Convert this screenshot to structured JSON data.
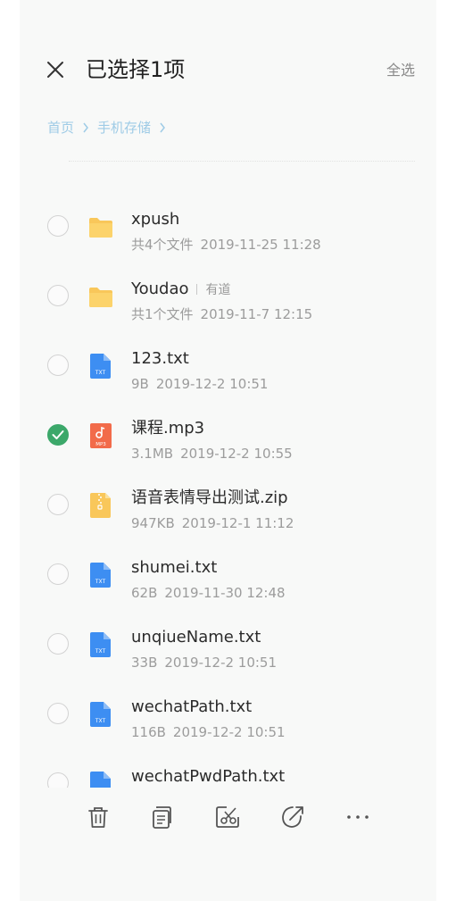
{
  "header": {
    "title": "已选择1项",
    "select_all": "全选"
  },
  "breadcrumb": [
    "首页",
    "手机存储"
  ],
  "files": [
    {
      "name": "xpush",
      "tag": "",
      "meta": "共4个文件",
      "date": "2019-11-25 11:28",
      "type": "folder",
      "checked": false
    },
    {
      "name": "Youdao",
      "tag": "有道",
      "meta": "共1个文件",
      "date": "2019-11-7 12:15",
      "type": "folder",
      "checked": false
    },
    {
      "name": "123.txt",
      "tag": "",
      "meta": "9B",
      "date": "2019-12-2 10:51",
      "type": "txt",
      "checked": false
    },
    {
      "name": "课程.mp3",
      "tag": "",
      "meta": "3.1MB",
      "date": "2019-12-2 10:55",
      "type": "mp3",
      "checked": true
    },
    {
      "name": "语音表情导出测试.zip",
      "tag": "",
      "meta": "947KB",
      "date": "2019-12-1 11:12",
      "type": "zip",
      "checked": false
    },
    {
      "name": "shumei.txt",
      "tag": "",
      "meta": "62B",
      "date": "2019-11-30 12:48",
      "type": "txt",
      "checked": false
    },
    {
      "name": "unqiueName.txt",
      "tag": "",
      "meta": "33B",
      "date": "2019-12-2 10:51",
      "type": "txt",
      "checked": false
    },
    {
      "name": "wechatPath.txt",
      "tag": "",
      "meta": "116B",
      "date": "2019-12-2 10:51",
      "type": "txt",
      "checked": false
    },
    {
      "name": "wechatPwdPath.txt",
      "tag": "",
      "meta": "",
      "date": "",
      "type": "txt",
      "checked": false
    }
  ],
  "icons": {
    "close": "close-icon",
    "delete": "trash-icon",
    "copy": "copy-icon",
    "move": "cut-icon",
    "share": "share-icon",
    "more": "more-icon"
  },
  "colors": {
    "accent_green": "#3ca86a",
    "folder_yellow": "#f9c75a",
    "txt_blue": "#3d8ef2",
    "mp3_orange": "#f26b4a",
    "breadcrumb_blue": "#9ecbe6"
  },
  "icon_text": {
    "txt": "TXT",
    "mp3": "MP3"
  }
}
